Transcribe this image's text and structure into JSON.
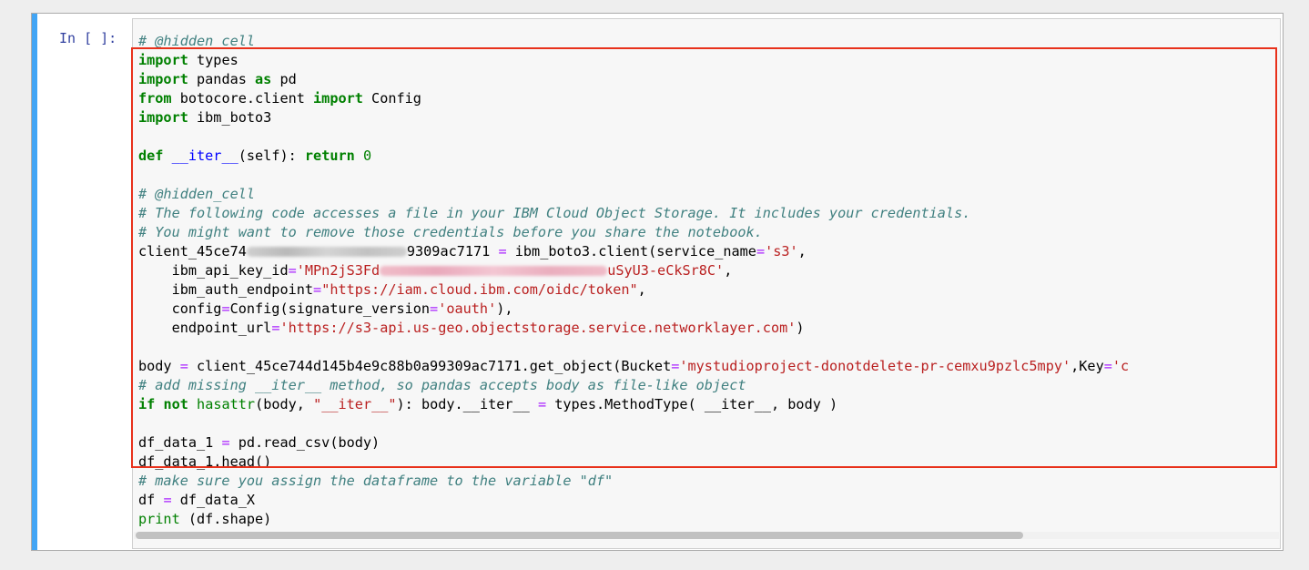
{
  "cell": {
    "prompt": "In [ ]:",
    "scrollbar_thumb_fraction": 0.775
  },
  "code": {
    "l1": "# @hidden_cell",
    "l2_kw": "import",
    "l2_rest": " types",
    "l3_kw1": "import",
    "l3_mid": " pandas ",
    "l3_kw2": "as",
    "l3_rest": " pd",
    "l4_kw1": "from",
    "l4_mid": " botocore.client ",
    "l4_kw2": "import",
    "l4_rest": " Config",
    "l5_kw": "import",
    "l5_rest": " ibm_boto3",
    "l7_kw": "def",
    "l7_fn": "__iter__",
    "l7_args": "(self): ",
    "l7_ret": "return",
    "l7_num": "0",
    "l9": "# @hidden_cell",
    "l10": "# The following code accesses a file in your IBM Cloud Object Storage. It includes your credentials.",
    "l11": "# You might want to remove those credentials before you share the notebook.",
    "l12_a": "client_45ce74",
    "l12_b": "9309ac7171 ",
    "l12_op": "=",
    "l12_c": " ibm_boto3.client(service_name",
    "l12_op2": "=",
    "l12_str": "'s3'",
    "l12_d": ",",
    "l13_a": "    ibm_api_key_id",
    "l13_op": "=",
    "l13_str1": "'MPn2jS3Fd",
    "l13_str2": "uSyU3-eCkSr8C'",
    "l13_d": ",",
    "l14_a": "    ibm_auth_endpoint",
    "l14_op": "=",
    "l14_str": "\"https://iam.cloud.ibm.com/oidc/token\"",
    "l14_d": ",",
    "l15_a": "    config",
    "l15_op": "=",
    "l15_b": "Config(signature_version",
    "l15_op2": "=",
    "l15_str": "'oauth'",
    "l15_d": "),",
    "l16_a": "    endpoint_url",
    "l16_op": "=",
    "l16_str": "'https://s3-api.us-geo.objectstorage.service.networklayer.com'",
    "l16_d": ")",
    "l18_a": "body ",
    "l18_op": "=",
    "l18_b": " client_45ce744d145b4e9c88b0a99309ac7171.get_object(Bucket",
    "l18_op2": "=",
    "l18_str": "'mystudioproject-donotdelete-pr-cemxu9pzlc5mpy'",
    "l18_c": ",Key",
    "l18_op3": "=",
    "l18_str2": "'c",
    "l19": "# add missing __iter__ method, so pandas accepts body as file-like object",
    "l20_kw": "if",
    "l20_sp": " ",
    "l20_not": "not",
    "l20_sp2": " ",
    "l20_bi": "hasattr",
    "l20_a": "(body, ",
    "l20_str": "\"__iter__\"",
    "l20_b": "): body.__iter__ ",
    "l20_op": "=",
    "l20_c": " types.MethodType( __iter__, body )",
    "l22_a": "df_data_1 ",
    "l22_op": "=",
    "l22_b": " pd.read_csv(body)",
    "l23": "df_data_1.head()",
    "l24": "# make sure you assign the dataframe to the variable \"df\"",
    "l25_a": "df ",
    "l25_op": "=",
    "l25_b": " df_data_X",
    "l26_bi": "print",
    "l26_a": " (df.shape)"
  },
  "colors": {
    "accent_bar": "#42a5f5",
    "highlight_box": "#e8311b",
    "keyword": "#008000",
    "operator": "#aa22ff",
    "string": "#ba2121",
    "comment": "#408080",
    "prompt": "#303f9f"
  }
}
